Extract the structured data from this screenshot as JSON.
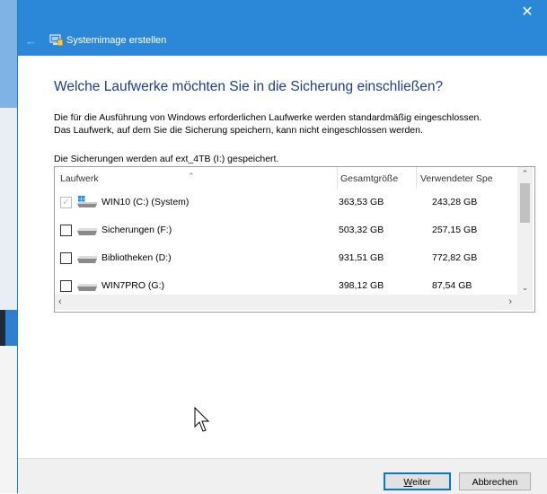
{
  "window": {
    "title": "Systemimage erstellen",
    "close_glyph": "✕",
    "back_glyph": "←"
  },
  "content": {
    "heading": "Welche Laufwerke möchten Sie in die Sicherung einschließen?",
    "description_line1": "Die für die Ausführung von Windows erforderlichen Laufwerke werden standardmäßig eingeschlossen.",
    "description_line2": "Das Laufwerk, auf dem Sie die Sicherung speichern, kann nicht eingeschlossen werden.",
    "saved_to": "Die Sicherungen werden auf ext_4TB (I:) gespeichert."
  },
  "table": {
    "columns": [
      "Laufwerk",
      "Gesamtgröße",
      "Verwendeter Spe"
    ],
    "rows": [
      {
        "name": "WIN10 (C:) (System)",
        "total": "363,53 GB",
        "used": "243,28 GB",
        "checked": true,
        "disabled": true,
        "icon": "windows-drive-icon"
      },
      {
        "name": "Sicherungen (F:)",
        "total": "503,32 GB",
        "used": "257,15 GB",
        "checked": false,
        "disabled": false,
        "icon": "hard-drive-icon"
      },
      {
        "name": "Bibliotheken (D:)",
        "total": "931,51 GB",
        "used": "772,82 GB",
        "checked": false,
        "disabled": false,
        "icon": "hard-drive-icon"
      },
      {
        "name": "WIN7PRO (G:)",
        "total": "398,12 GB",
        "used": "87,54 GB",
        "checked": false,
        "disabled": false,
        "icon": "hard-drive-icon"
      }
    ]
  },
  "footer": {
    "next_prefix": "W",
    "next_rest": "eiter",
    "cancel_label": "Abbrechen"
  },
  "colors": {
    "titlebar": "#2b88d8",
    "heading": "#1e3f8a",
    "accent": "#0078d7"
  }
}
